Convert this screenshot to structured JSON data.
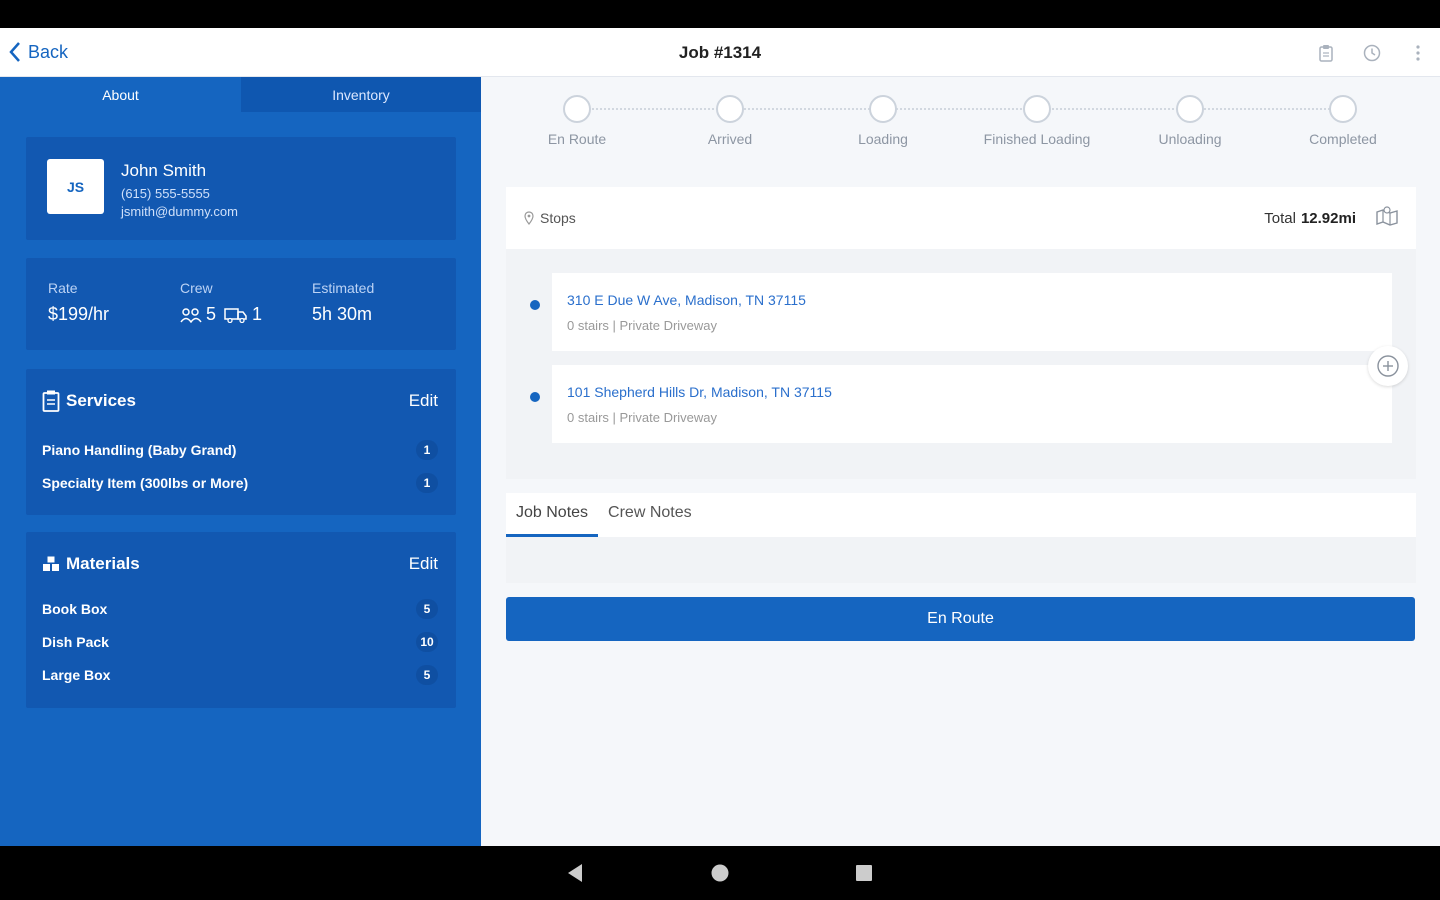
{
  "app_bar": {
    "back_label": "Back",
    "title": "Job #1314",
    "actions": [
      "clipboard-icon",
      "clock-icon",
      "more-vert-icon"
    ]
  },
  "left": {
    "tabs": [
      {
        "label": "About",
        "active": true
      },
      {
        "label": "Inventory",
        "active": false
      }
    ],
    "contact": {
      "initials": "JS",
      "name": "John Smith",
      "phone": "(615) 555-5555",
      "email": "jsmith@dummy.com"
    },
    "stats": {
      "rate_label": "Rate",
      "rate_value": "$199/hr",
      "crew_label": "Crew",
      "crew_people": "5",
      "crew_trucks": "1",
      "estimated_label": "Estimated",
      "estimated_value": "5h 30m"
    },
    "services": {
      "title": "Services",
      "edit_label": "Edit",
      "items": [
        {
          "name": "Piano Handling (Baby Grand)",
          "qty": "1"
        },
        {
          "name": "Specialty Item (300lbs or More)",
          "qty": "1"
        }
      ]
    },
    "materials": {
      "title": "Materials",
      "edit_label": "Edit",
      "items": [
        {
          "name": "Book Box",
          "qty": "5"
        },
        {
          "name": "Dish Pack",
          "qty": "10"
        },
        {
          "name": "Large Box",
          "qty": "5"
        }
      ]
    }
  },
  "right": {
    "steps": [
      "En Route",
      "Arrived",
      "Loading",
      "Finished Loading",
      "Unloading",
      "Completed"
    ],
    "stops": {
      "title": "Stops",
      "total_label": "Total",
      "total_value": "12.92mi",
      "items": [
        {
          "address": "310 E Due W Ave, Madison, TN 37115",
          "meta": "0 stairs | Private Driveway"
        },
        {
          "address": "101 Shepherd Hills Dr, Madison, TN 37115",
          "meta": "0 stairs | Private Driveway"
        }
      ]
    },
    "notes": {
      "tabs": [
        {
          "label": "Job Notes",
          "active": true
        },
        {
          "label": "Crew Notes",
          "active": false
        }
      ]
    },
    "primary_button": "En Route"
  },
  "colors": {
    "brand": "#1565c0",
    "panel_card": "#1258b1",
    "link": "#2a6fcc"
  }
}
